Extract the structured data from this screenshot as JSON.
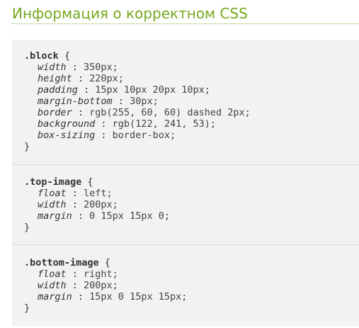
{
  "heading": "Информация о корректном CSS",
  "blocks": [
    {
      "selector": ".block",
      "open": " {",
      "declarations": [
        {
          "prop": "width",
          "sep": " : ",
          "value": "350px;"
        },
        {
          "prop": "height",
          "sep": " : ",
          "value": "220px;"
        },
        {
          "prop": "padding",
          "sep": " : ",
          "value": "15px 10px 20px 10px;"
        },
        {
          "prop": "margin-bottom",
          "sep": " : ",
          "value": "30px;"
        },
        {
          "prop": "border",
          "sep": " : ",
          "value": "rgb(255, 60, 60) dashed 2px;"
        },
        {
          "prop": "background",
          "sep": " : ",
          "value": "rgb(122, 241, 53);"
        },
        {
          "prop": "box-sizing",
          "sep": " : ",
          "value": "border-box;"
        }
      ],
      "close": "}"
    },
    {
      "selector": ".top-image",
      "open": " {",
      "declarations": [
        {
          "prop": "float",
          "sep": " : ",
          "value": "left;"
        },
        {
          "prop": "width",
          "sep": " : ",
          "value": "200px;"
        },
        {
          "prop": "margin",
          "sep": " : ",
          "value": "0 15px 15px 0;"
        }
      ],
      "close": "}"
    },
    {
      "selector": ".bottom-image",
      "open": " {",
      "declarations": [
        {
          "prop": "float",
          "sep": " : ",
          "value": "right;"
        },
        {
          "prop": "width",
          "sep": " : ",
          "value": "200px;"
        },
        {
          "prop": "margin",
          "sep": " : ",
          "value": "15px 0 15px 15px;"
        }
      ],
      "close": "}"
    }
  ],
  "colors": {
    "heading": "#76a820",
    "code_background": "#f2f2f2"
  }
}
